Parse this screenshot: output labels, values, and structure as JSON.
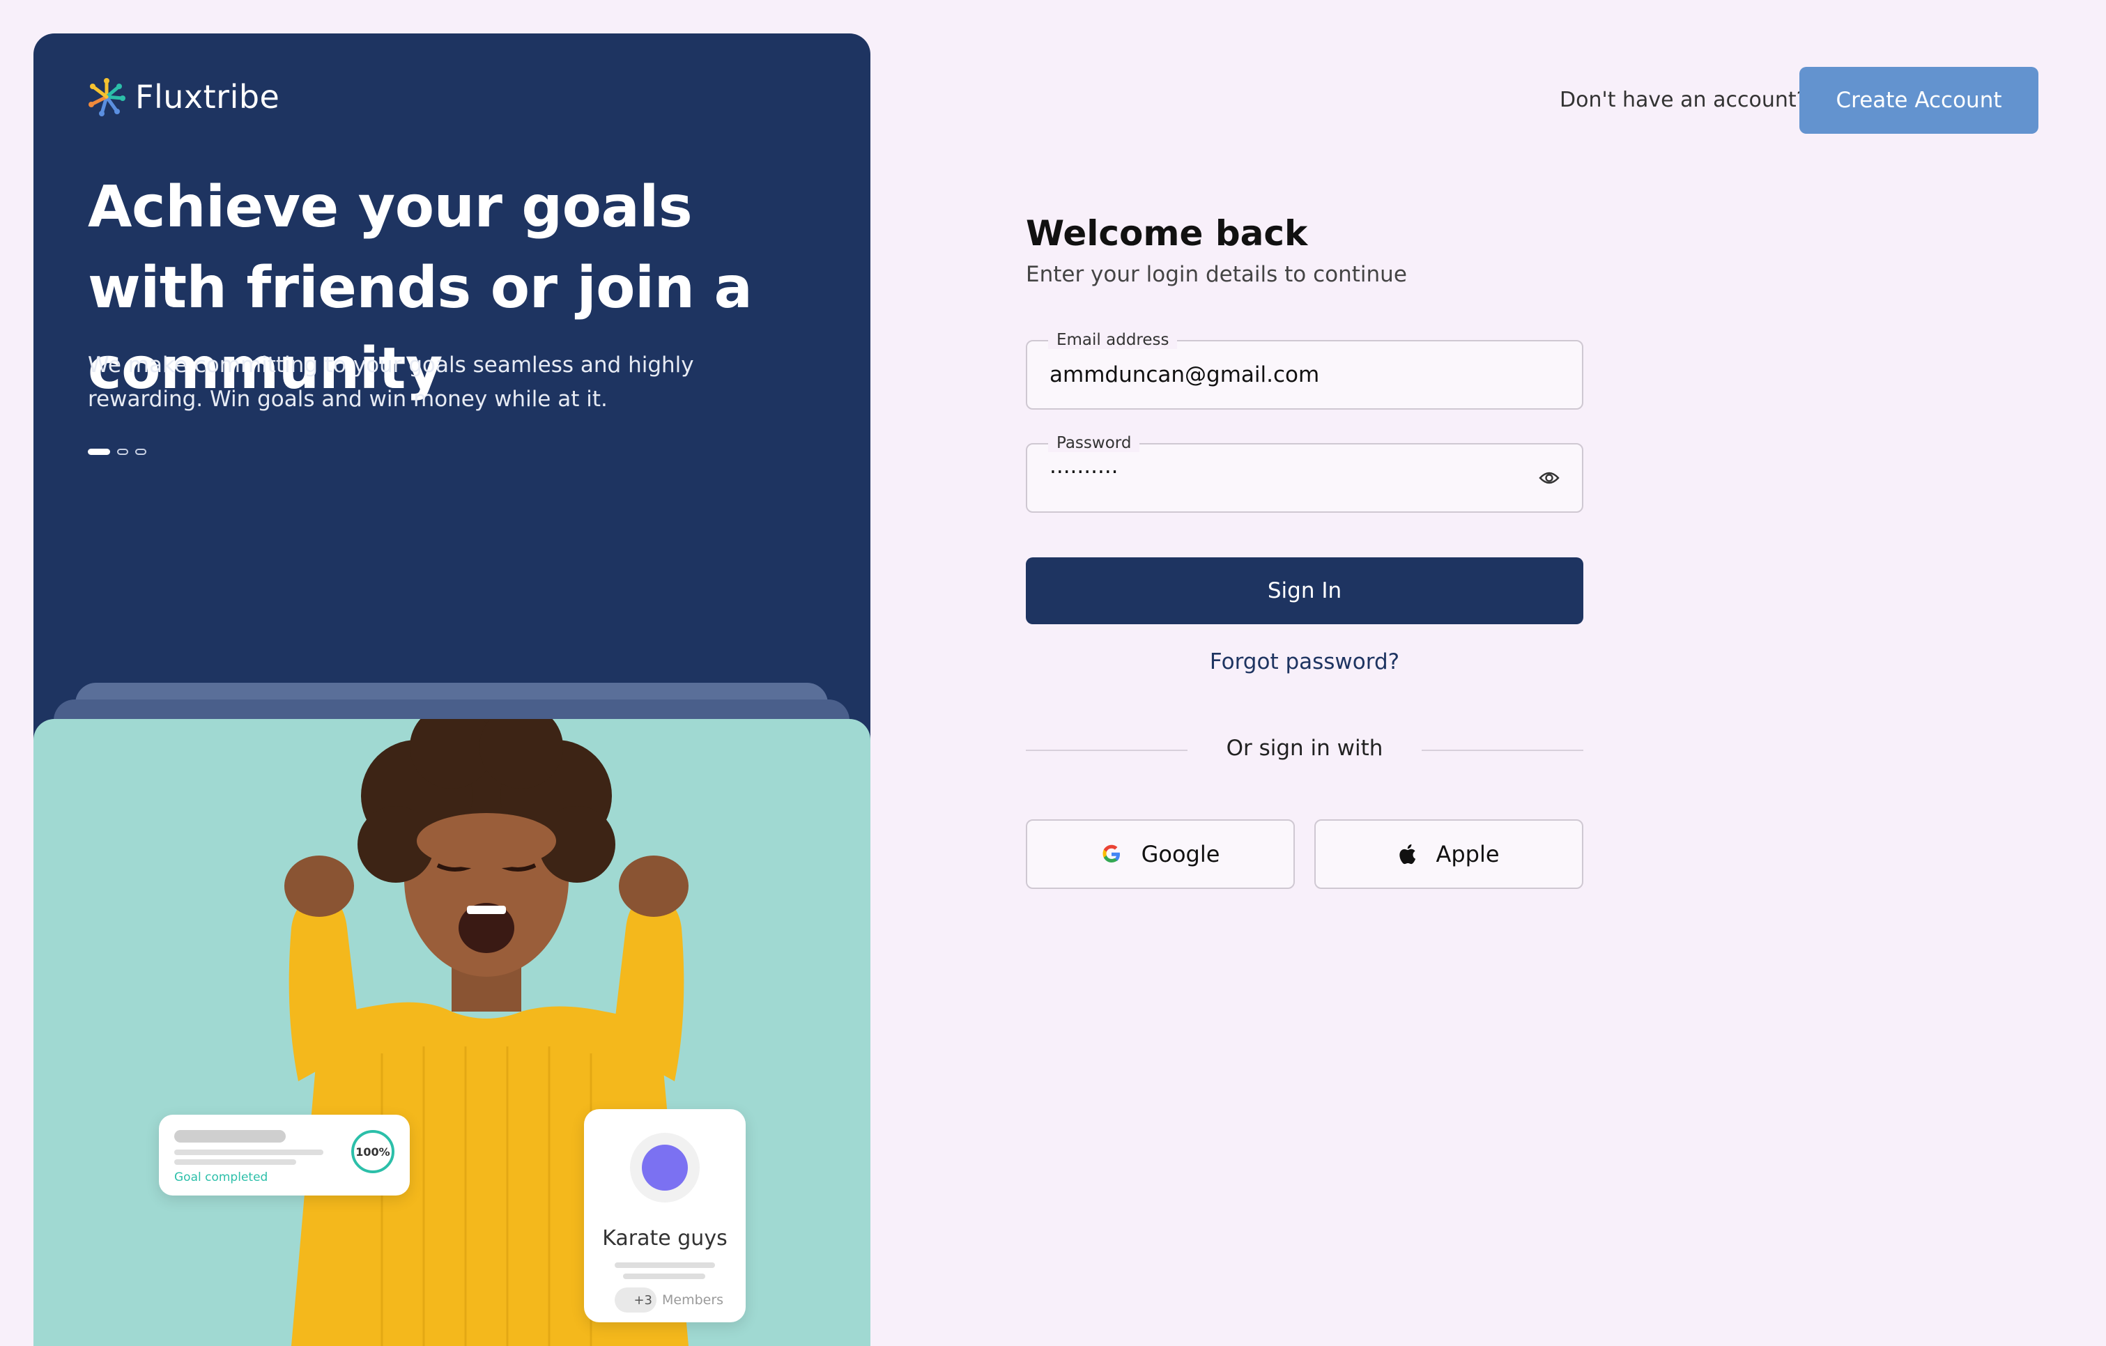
{
  "brand": {
    "name": "Fluxtribe"
  },
  "hero": {
    "title": "Achieve your goals with friends or join a community",
    "subtitle": "We make committing to your goals seamless and highly rewarding. Win goals and win money while at it.",
    "carousel": {
      "slides": 3,
      "active_index": 0
    },
    "goal_card": {
      "progress_label": "100%",
      "status": "Goal completed"
    },
    "group_card": {
      "name": "Karate guys",
      "member_extra": "+3",
      "members_label": "Members"
    }
  },
  "header": {
    "prompt": "Don't have an account?",
    "create_account_label": "Create Account"
  },
  "form": {
    "title": "Welcome back",
    "subtitle": "Enter your login details to continue",
    "email": {
      "label": "Email address",
      "value": "ammduncan@gmail.com"
    },
    "password": {
      "label": "Password",
      "value": "··········",
      "toggle_icon": "eye-icon"
    },
    "sign_in_label": "Sign In",
    "forgot_label": "Forgot password?",
    "divider_label": "Or sign in with",
    "social": {
      "google_label": "Google",
      "apple_label": "Apple"
    }
  },
  "colors": {
    "background": "#f8f0fa",
    "hero_navy": "#1e3461",
    "accent_blue": "#6393cf",
    "photo_mint": "#a0d9d2",
    "goal_teal": "#2cbfa9",
    "avatar_purple": "#7b71f2"
  }
}
